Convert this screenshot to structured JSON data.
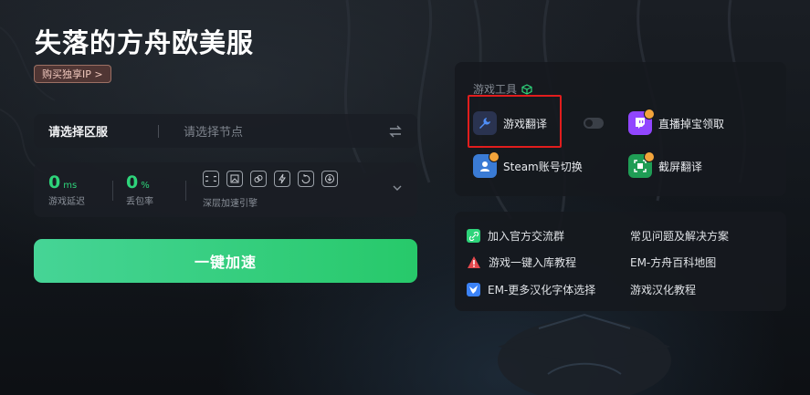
{
  "header": {
    "title": "失落的方舟欧美服",
    "exclusive_ip_label": "购买独享IP >"
  },
  "server_select": {
    "region_label": "请选择区服",
    "node_placeholder": "请选择节点"
  },
  "stats": {
    "latency": {
      "value": "0",
      "unit": "ms",
      "label": "游戏延迟"
    },
    "packet_loss": {
      "value": "0",
      "unit": "%",
      "label": "丢包率"
    },
    "deep_acceleration_label": "深层加速引擎",
    "tool_icons": [
      "loop-icon",
      "image-icon",
      "link-icon",
      "lightning-icon",
      "refresh-icon",
      "download-icon"
    ]
  },
  "accelerate_button": "一键加速",
  "game_tools": {
    "title": "游戏工具",
    "items": [
      {
        "label": "游戏翻译",
        "icon": "translate-wrench-icon"
      },
      {
        "label": "直播掉宝领取",
        "icon": "twitch-icon"
      },
      {
        "label": "Steam账号切换",
        "icon": "steam-account-icon"
      },
      {
        "label": "截屏翻译",
        "icon": "screenshot-translate-icon"
      }
    ]
  },
  "links": {
    "left": [
      {
        "label": "加入官方交流群",
        "icon": "link-icon"
      },
      {
        "label": "游戏一键入库教程",
        "icon": "warning-icon"
      },
      {
        "label": "EM-更多汉化字体选择",
        "icon": "bird-icon"
      }
    ],
    "right": [
      {
        "label": "常见问题及解决方案"
      },
      {
        "label": "EM-方舟百科地图"
      },
      {
        "label": "游戏汉化教程"
      }
    ]
  },
  "colors": {
    "accent_green": "#2ed47a",
    "highlight_red": "#e11d1d",
    "badge_orange": "#f3a43b"
  }
}
